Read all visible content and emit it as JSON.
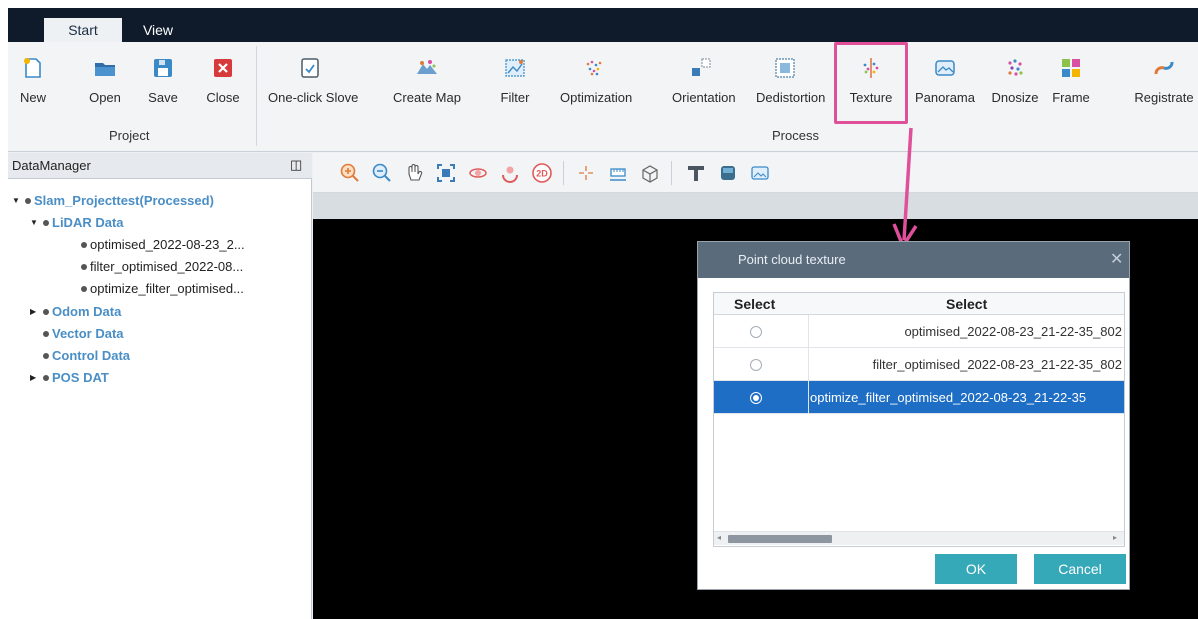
{
  "menu": {
    "tabs": [
      "Start",
      "View"
    ]
  },
  "ribbon": {
    "project_group": "Project",
    "process_group": "Process",
    "buttons": [
      {
        "label": "New",
        "icon": "new-file-icon"
      },
      {
        "label": "Open",
        "icon": "open-folder-icon"
      },
      {
        "label": "Save",
        "icon": "save-icon"
      },
      {
        "label": "Close",
        "icon": "close-icon"
      },
      {
        "label": "One-click Slove",
        "icon": "one-click-icon"
      },
      {
        "label": "Create Map",
        "icon": "create-map-icon"
      },
      {
        "label": "Filter",
        "icon": "filter-icon"
      },
      {
        "label": "Optimization",
        "icon": "optimization-icon"
      },
      {
        "label": "Orientation",
        "icon": "orientation-icon"
      },
      {
        "label": "Dedistortion",
        "icon": "dedistortion-icon"
      },
      {
        "label": "Texture",
        "icon": "texture-icon"
      },
      {
        "label": "Panorama",
        "icon": "panorama-icon"
      },
      {
        "label": "Dnosize",
        "icon": "denoise-icon"
      },
      {
        "label": "Frame",
        "icon": "frame-icon"
      },
      {
        "label": "Registrate",
        "icon": "registrate-icon"
      }
    ],
    "highlight_color": "#e0509a"
  },
  "datamanager": {
    "title": "DataManager",
    "pin": "ȡ",
    "tree": [
      {
        "label": "Slam_Projecttest(Processed)",
        "style": "bold",
        "toggle": "▼"
      },
      {
        "label": "LiDAR Data",
        "style": "bold",
        "toggle": "▼"
      },
      {
        "label": "optimised_2022-08-23_2...",
        "style": "plain",
        "toggle": ""
      },
      {
        "label": "filter_optimised_2022-08...",
        "style": "plain",
        "toggle": ""
      },
      {
        "label": "optimize_filter_optimised...",
        "style": "plain",
        "toggle": ""
      },
      {
        "label": "Odom Data",
        "style": "bold",
        "toggle": "▶"
      },
      {
        "label": "Vector Data",
        "style": "bold",
        "toggle": ""
      },
      {
        "label": "Control Data",
        "style": "bold",
        "toggle": ""
      },
      {
        "label": "POS DAT",
        "style": "bold",
        "toggle": "▶"
      }
    ]
  },
  "view_toolbar": {
    "icons": [
      "zoom-in-icon",
      "zoom-out-icon",
      "pan-hand-icon",
      "fit-view-icon",
      "rotate-icon",
      "orbit-icon",
      "2d-view-icon",
      "point-pick-icon",
      "measure-icon",
      "box-select-icon",
      "elevation-icon",
      "color-icon",
      "screenshot-icon"
    ],
    "label_2d": "2D"
  },
  "dialog": {
    "title": "Point cloud texture",
    "close": "✕",
    "columns": [
      "Select",
      "Select"
    ],
    "rows": [
      {
        "name": "optimised_2022-08-23_21-22-35_802",
        "selected": false
      },
      {
        "name": "filter_optimised_2022-08-23_21-22-35_802",
        "selected": false
      },
      {
        "name": "optimize_filter_optimised_2022-08-23_21-22-35",
        "selected": true
      }
    ],
    "ok": "OK",
    "cancel": "Cancel",
    "scroll_left": "◂",
    "scroll_right": "▸"
  }
}
